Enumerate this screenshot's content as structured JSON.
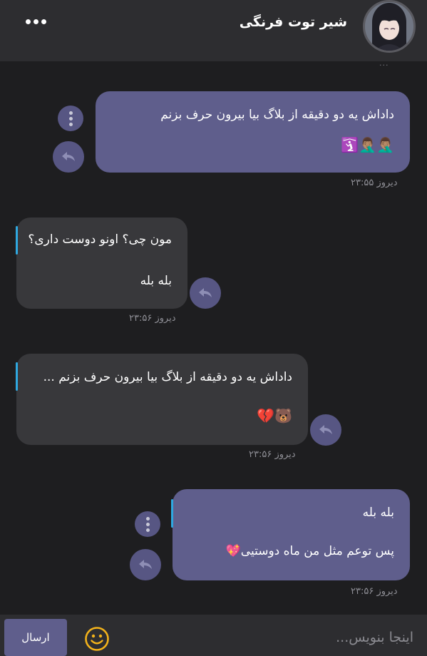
{
  "header": {
    "title": "شیر توت فرنگی",
    "menu_icon": "more-dots-icon",
    "avatar_icon": "user-avatar"
  },
  "messages": [
    {
      "direction": "outgoing",
      "lines": [
        "داداش یه دو دقیقه از بلاگ بیا بیرون حرف بزنم"
      ],
      "emoji": "🤦🏽‍♂️🤦🏽‍♂️🛐",
      "time": "دیروز ۲۳:۵۵",
      "icons": [
        "kebab-menu-icon",
        "reply-icon"
      ]
    },
    {
      "direction": "incoming",
      "quote": "مون چی؟ اونو دوست داری؟",
      "lines": [
        "بله بله"
      ],
      "time": "دیروز ۲۳:۵۶",
      "icons": [
        "reply-icon"
      ]
    },
    {
      "direction": "incoming",
      "quote": "داداش یه دو دقیقه از بلاگ بیا بیرون حرف بزنم ...",
      "emoji": "🐻💔",
      "time": "دیروز ۲۳:۵۶",
      "icons": [
        "reply-icon"
      ]
    },
    {
      "direction": "outgoing",
      "quote": "بله بله",
      "lines": [
        "پس توعم مثل من ماه دوستیی💖"
      ],
      "time": "دیروز ۲۳:۵۶",
      "icons": [
        "kebab-menu-icon",
        "reply-icon"
      ]
    }
  ],
  "composer": {
    "placeholder": "اینجا بنویس...",
    "send_label": "ارسال",
    "emoji_icon": "smiley-icon"
  },
  "colors": {
    "background": "#1e1e20",
    "header": "#2d2d30",
    "outgoing_bubble": "#5f5e8c",
    "incoming_bubble": "#38383b",
    "quote_accent": "#2fa8e0",
    "emoji_button": "#f2b21b"
  }
}
